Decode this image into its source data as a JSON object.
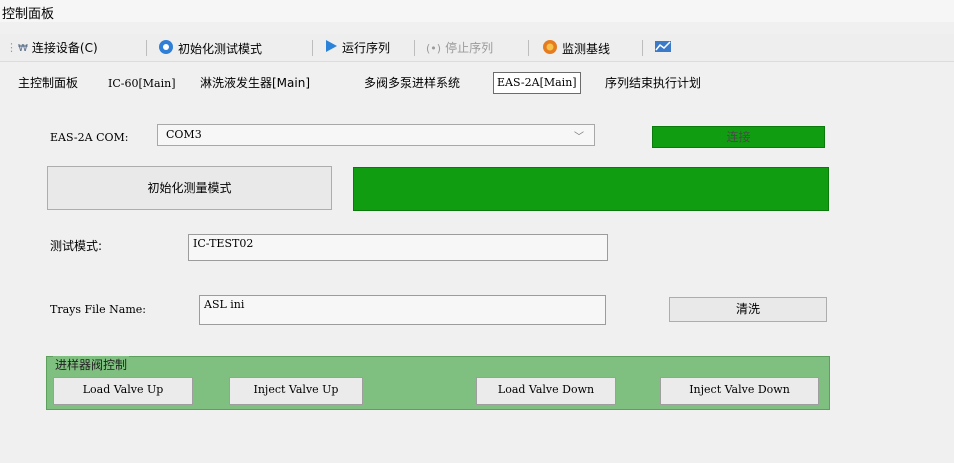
{
  "window": {
    "title": "控制面板"
  },
  "toolbar": {
    "connect": "连接设备(C)",
    "init_test_mode": "初始化测试模式",
    "run_sequence": "运行序列",
    "stop_sequence": "停止序列",
    "monitor_baseline": "监测基线"
  },
  "tabs": [
    "主控制面板",
    "IC-60[Main]",
    "淋洗液发生器[Main]",
    "多阀多泵进样系统",
    "EAS-2A[Main]",
    "序列结束执行计划"
  ],
  "form": {
    "com_label": "EAS-2A COM:",
    "com_value": "COM3",
    "connect_status": "连接",
    "init_measure_button": "初始化测量模式",
    "test_mode_label": "测试模式:",
    "test_mode_value": "IC-TEST02",
    "trays_label": "Trays File Name:",
    "trays_value": "ASL ini",
    "clean_button": "清洗"
  },
  "valve_group": {
    "title": "进样器阀控制",
    "load_up": "Load Valve Up",
    "inject_up": "Inject Valve Up",
    "load_down": "Load Valve Down",
    "inject_down": "Inject Valve Down"
  },
  "colors": {
    "status_green": "#119d11",
    "group_green": "#7fbf7f"
  }
}
